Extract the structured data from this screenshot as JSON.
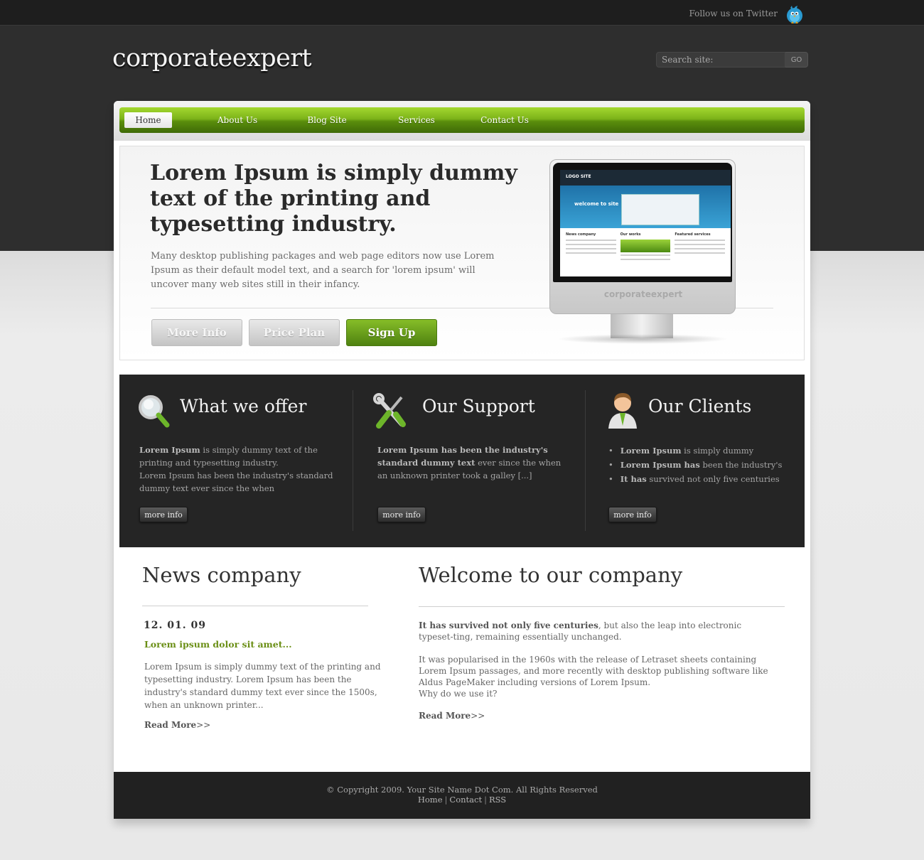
{
  "header": {
    "twitter_label": "Follow us on Twitter",
    "logo": "corporateexpert",
    "search_placeholder": "Search site:",
    "search_button": "GO"
  },
  "nav": {
    "items": [
      "Home",
      "About Us",
      "Blog Site",
      "Services",
      "Contact Us"
    ],
    "active": "Home"
  },
  "hero": {
    "title": "Lorem Ipsum is simply dummy text of the printing and typesetting industry.",
    "text": "Many desktop publishing packages and web page editors now use Lorem Ipsum as their default model text, and a search for 'lorem ipsum' will uncover many web sites still in their infancy.",
    "buttons": [
      "More Info",
      "Price Plan",
      "Sign Up"
    ],
    "monitor_brand": "corporateexpert",
    "screen_logo": "LOGO SITE",
    "screen_welcome": "welcome to site",
    "screen_cols": [
      "News company",
      "Our works",
      "Featured services"
    ]
  },
  "features": {
    "offer": {
      "title": "What we offer",
      "bold1": "Lorem Ipsum",
      "text1": " is simply dummy text of the printing and typesetting industry.",
      "text2": "Lorem Ipsum has been the industry's standard dummy text ever since the when",
      "button": "more info"
    },
    "support": {
      "title": "Our Support",
      "bold1": "Lorem Ipsum has been the industry's standard dummy text",
      "text1": " ever since the when an unknown printer took a galley [...]",
      "button": "more info"
    },
    "clients": {
      "title": "Our Clients",
      "items": [
        {
          "bold": "Lorem Ipsum",
          "text": " is simply dummy"
        },
        {
          "bold": "Lorem Ipsum has",
          "text": " been the industry's"
        },
        {
          "bold": "It has",
          "text": " survived not only five centuries"
        }
      ],
      "button": "more info"
    }
  },
  "news": {
    "title": "News company",
    "date": "12. 01. 09",
    "headline": "Lorem ipsum dolor sit amet...",
    "text": "Lorem Ipsum is simply dummy text of the printing and typesetting industry. Lorem Ipsum has been the industry's standard dummy text ever since the 1500s, when an unknown printer...",
    "read_more": "Read More",
    "read_more_suffix": ">>"
  },
  "welcome": {
    "title": "Welcome to our company",
    "bold": "It has survived not only five centuries",
    "text1": ", but also the leap into electronic typeset-ting, remaining essentially unchanged.",
    "text2": "It was popularised in the 1960s with the release of Letraset sheets containing Lorem Ipsum passages, and more recently with desktop publishing software like Aldus PageMaker including versions of Lorem Ipsum.",
    "text3": "Why do we use it?",
    "read_more": "Read More",
    "read_more_suffix": ">>"
  },
  "footer": {
    "copyright": "© Copyright 2009. Your Site Name Dot Com. All Rights Reserved",
    "links": [
      "Home",
      "Contact",
      "RSS"
    ],
    "separator": "|"
  },
  "colors": {
    "accent_green": "#6b8f16",
    "nav_green": "#7cb319",
    "dark_band": "#252525"
  },
  "icons": [
    "twitter-bird-icon",
    "magnifier-icon",
    "tools-icon",
    "client-person-icon"
  ]
}
